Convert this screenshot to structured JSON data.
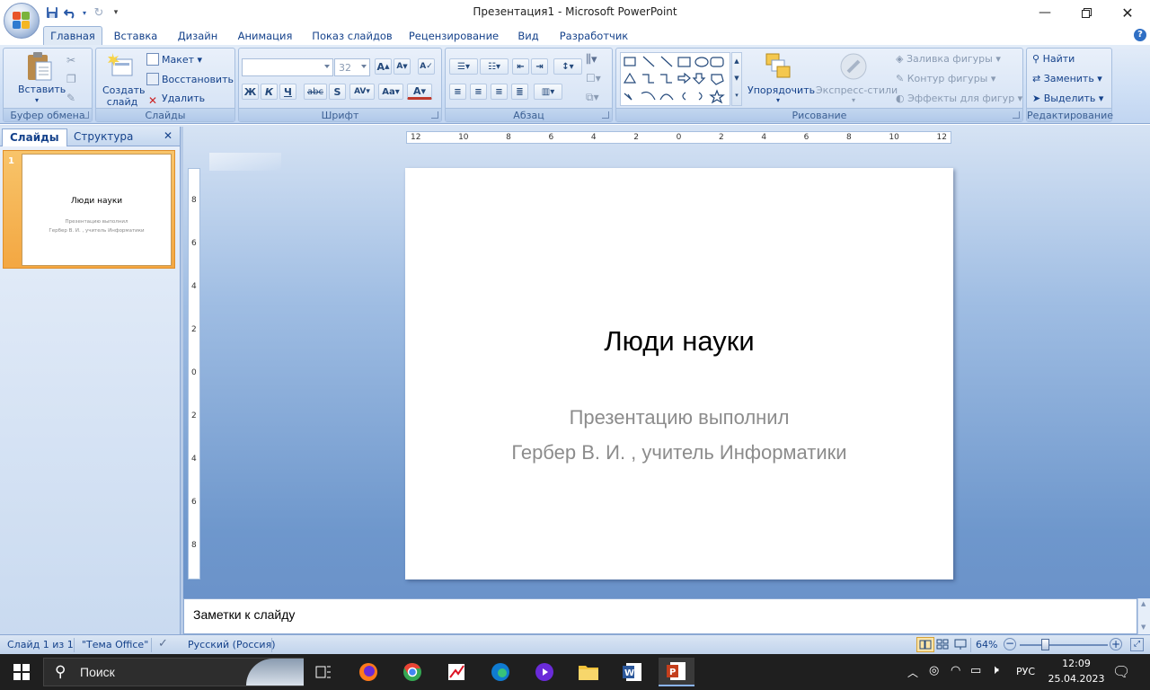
{
  "window": {
    "title": "Презентация1 - Microsoft PowerPoint",
    "minimize_icon": "minimize-icon",
    "maximize_icon": "restore-icon",
    "close_icon": "close-icon"
  },
  "quick_access": {
    "save_icon": "save-icon",
    "undo_icon": "undo-icon",
    "redo_icon": "redo-icon",
    "customize_icon": "chevron-down-icon"
  },
  "tabs": [
    {
      "label": "Главная",
      "active": true
    },
    {
      "label": "Вставка"
    },
    {
      "label": "Дизайн"
    },
    {
      "label": "Анимация"
    },
    {
      "label": "Показ слайдов"
    },
    {
      "label": "Рецензирование"
    },
    {
      "label": "Вид"
    },
    {
      "label": "Разработчик"
    }
  ],
  "ribbon": {
    "clipboard": {
      "label": "Буфер обмена",
      "paste": "Вставить"
    },
    "slides": {
      "label": "Слайды",
      "new_slide": "Создать слайд",
      "layout": "Макет",
      "reset": "Восстановить",
      "delete": "Удалить"
    },
    "font": {
      "label": "Шрифт",
      "font_name": "",
      "font_size": "32"
    },
    "paragraph": {
      "label": "Абзац"
    },
    "drawing": {
      "label": "Рисование",
      "arrange": "Упорядочить",
      "quick_styles": "Экспресс-стили",
      "shape_fill": "Заливка фигуры",
      "shape_outline": "Контур фигуры",
      "shape_effects": "Эффекты для фигур"
    },
    "editing": {
      "label": "Редактирование",
      "find": "Найти",
      "replace": "Заменить",
      "select": "Выделить"
    }
  },
  "left_panel": {
    "tab_slides": "Слайды",
    "tab_outline": "Структура",
    "thumb_number": "1",
    "thumb_title": "Люди науки",
    "thumb_sub1": "Презентацию выполнил",
    "thumb_sub2": "Гербер В. И. , учитель Информатики"
  },
  "slide": {
    "title": "Люди науки",
    "subtitle_line1": "Презентацию выполнил",
    "subtitle_line2": "Гербер В. И. , учитель Информатики"
  },
  "ruler": {
    "h_labels": [
      "12",
      "10",
      "8",
      "6",
      "4",
      "2",
      "0",
      "2",
      "4",
      "6",
      "8",
      "10",
      "12"
    ],
    "v_labels": [
      "8",
      "6",
      "4",
      "2",
      "0",
      "2",
      "4",
      "6",
      "8"
    ]
  },
  "notes": {
    "placeholder": "Заметки к слайду"
  },
  "status": {
    "slide_counter": "Слайд 1 из 1",
    "theme": "\"Тема Office\"",
    "language": "Русский (Россия)",
    "zoom": "64%"
  },
  "taskbar": {
    "search_label": "Поиск",
    "language": "РУС",
    "time": "12:09",
    "date": "25.04.2023"
  },
  "colors": {
    "ribbon_blue": "#dfe9f5",
    "accent": "#15428b",
    "active_thumb": "#f5b04f"
  }
}
